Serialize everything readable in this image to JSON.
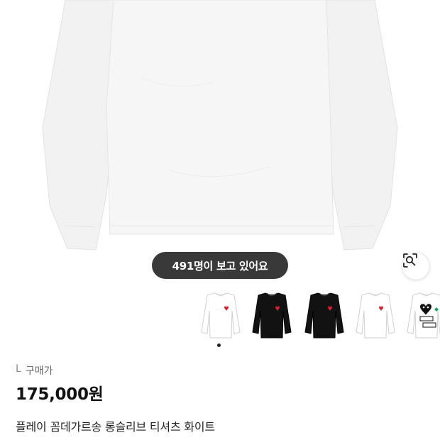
{
  "viewer_badge": {
    "text": "491명이 보고 있어요"
  },
  "lens_button": {
    "icon": "image-search-icon"
  },
  "thumbnails": [
    {
      "name": "thumb-white-longsleeve",
      "color": "#ffffff"
    },
    {
      "name": "thumb-black-longsleeve",
      "color": "#111111"
    },
    {
      "name": "thumb-black-longsleeve-2",
      "color": "#111111"
    },
    {
      "name": "thumb-white-longsleeve-2",
      "color": "#ffffff"
    },
    {
      "name": "thumb-white-graphic-tee",
      "color": "#ffffff"
    }
  ],
  "carousel": {
    "current_index": 1,
    "page_count": 1
  },
  "info": {
    "size": "L",
    "price_label": "구매가",
    "price": "175,000원",
    "product_name": "플레이 꼼데가르송 롱슬리브 티셔츠 화이트"
  },
  "colors": {
    "heart": "#d8202c",
    "pill_bg": "#1e1e1e"
  }
}
